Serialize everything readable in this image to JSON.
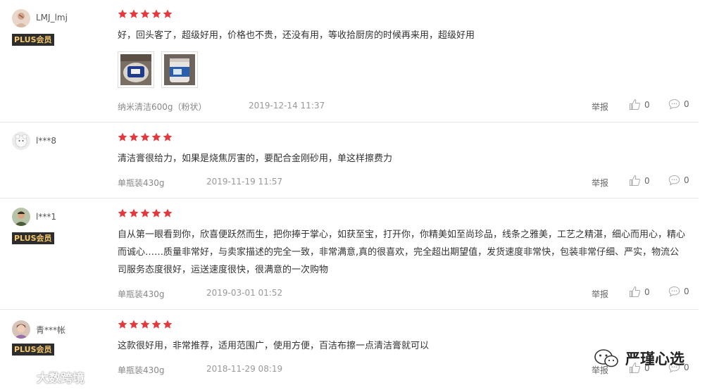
{
  "reviews": [
    {
      "username": "LMJ_lmj",
      "badge": "PLUS会员",
      "rating": 5,
      "text": "好，回头客了，超级好用，价格也不贵，还没有用，等收拾厨房的时候再来用，超级好用",
      "spec": "纳米清洁600g（粉状）",
      "date": "2019-12-14 11:37",
      "report": "举报",
      "likes": "0",
      "replies": "0"
    },
    {
      "username": "l***8",
      "badge": "",
      "rating": 5,
      "text": "清洁膏很给力，如果是烧焦厉害的，要配合金刚砂用，单这样擦费力",
      "spec": "单瓶装430g",
      "date": "2019-11-19 11:57",
      "report": "举报",
      "likes": "0",
      "replies": "0"
    },
    {
      "username": "l***1",
      "badge": "PLUS会员",
      "rating": 5,
      "text": "自从第一眼看到你，欣喜便跃然而生，把你捧于掌心，如获至宝，打开你，你精美如至尚珍品，线条之雅美，工艺之精湛，细心而用心，精心而诚心……质量非常好，与卖家描述的完全一致，非常满意,真的很喜欢，完全超出期望值，发货速度非常快，包装非常仔细、严实，物流公司服务态度很好，运送速度很快，很满意的一次购物",
      "spec": "单瓶装430g",
      "date": "2019-03-01 01:52",
      "report": "举报",
      "likes": "0",
      "replies": "0"
    },
    {
      "username": "青***帐",
      "badge": "PLUS会员",
      "rating": 5,
      "text": "这款很好用，非常推荐，适用范围广，使用方便，百洁布擦一点清洁膏就可以",
      "spec": "单瓶装430g",
      "date": "2018-11-29 08:19",
      "report": "举报",
      "likes": "0",
      "replies": "0"
    }
  ],
  "watermarks": {
    "left": "大数跨境",
    "right": "严瑾心选"
  },
  "colors": {
    "star": "#e4393c",
    "badge_bg": "#2d2d2d",
    "badge_text": "#f5c76a"
  }
}
